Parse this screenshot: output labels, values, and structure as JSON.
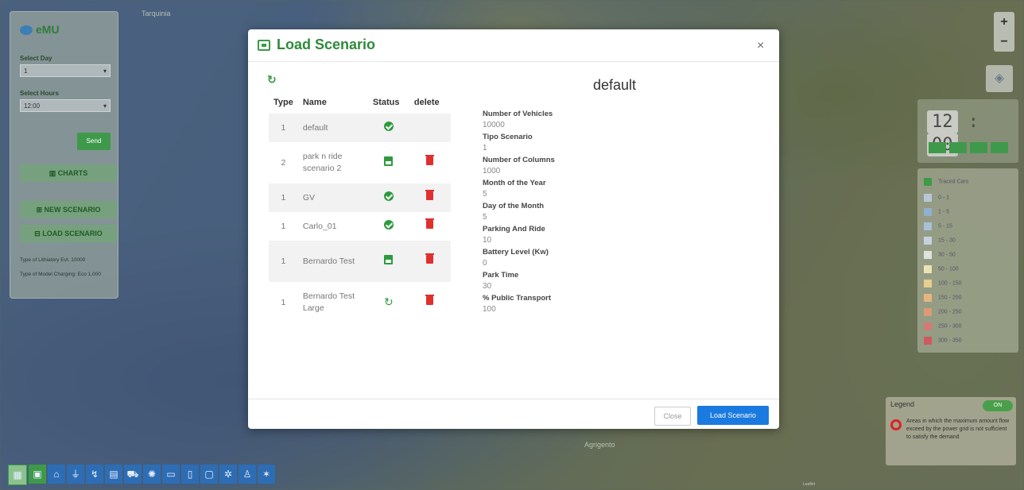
{
  "map": {
    "labels": [
      "Tarquinia",
      "Agrigento"
    ]
  },
  "left_panel": {
    "app_name": "eMU",
    "select_day_label": "Select Day",
    "select_day_value": "1",
    "select_hours_label": "Select Hours",
    "select_hours_value": "12:00",
    "send_label": "Send",
    "charts_label": "CHARTS",
    "new_scenario_label": "NEW SCENARIO",
    "load_scenario_label": "LOAD SCENARIO",
    "note_1": "Type of Lithiatery Evt. 10000",
    "note_2": "Type of Model Charging: Eco 1,000"
  },
  "clock": {
    "hours": "12",
    "minutes": "00"
  },
  "color_legend": {
    "title": "Traced Cars",
    "rows": [
      {
        "label": "0 - 1",
        "color": "#b8c7d6"
      },
      {
        "label": "1 - 5",
        "color": "#8fb0cf"
      },
      {
        "label": "5 - 15",
        "color": "#a7c1d9"
      },
      {
        "label": "15 - 30",
        "color": "#c4d2e0"
      },
      {
        "label": "30 - 50",
        "color": "#dfe3dc"
      },
      {
        "label": "50 - 100",
        "color": "#ece3b5"
      },
      {
        "label": "100 - 150",
        "color": "#e7cf8f"
      },
      {
        "label": "150 - 200",
        "color": "#e4b67e"
      },
      {
        "label": "200 - 250",
        "color": "#dc9b72"
      },
      {
        "label": "250 - 300",
        "color": "#d47b74"
      },
      {
        "label": "300 - 350",
        "color": "#cc5a63"
      }
    ]
  },
  "legend": {
    "title": "Legend",
    "toggle": "ON",
    "description": "Areas in which the maximum amount flow exceed by the power grid is not sufficient to satisfy the demand"
  },
  "modal": {
    "title": "Load Scenario",
    "close_symbol": "×",
    "table": {
      "headers": [
        "Type",
        "Name",
        "Status",
        "delete"
      ],
      "rows": [
        {
          "type": "1",
          "name": "default",
          "status": "ok",
          "deletable": false
        },
        {
          "type": "2",
          "name": "park n ride scenario 2",
          "status": "saved",
          "deletable": true
        },
        {
          "type": "1",
          "name": "GV",
          "status": "ok",
          "deletable": true
        },
        {
          "type": "1",
          "name": "Carlo_01",
          "status": "ok",
          "deletable": true
        },
        {
          "type": "1",
          "name": "Bernardo Test",
          "status": "saved",
          "deletable": true
        },
        {
          "type": "1",
          "name": "Bernardo Test Large",
          "status": "loading",
          "deletable": true
        }
      ]
    },
    "selected": {
      "name": "default",
      "fields": [
        {
          "label": "Number of Vehicles",
          "value": "10000"
        },
        {
          "label": "Tipo Scenario",
          "value": "1"
        },
        {
          "label": "Number of Columns",
          "value": "1000"
        },
        {
          "label": "Month of the Year",
          "value": "5"
        },
        {
          "label": "Day of the Month",
          "value": "5"
        },
        {
          "label": "Parking And Ride",
          "value": "10"
        },
        {
          "label": "Battery Level (Kw)",
          "value": "0"
        },
        {
          "label": "Park Time",
          "value": "30"
        },
        {
          "label": "% Public Transport",
          "value": "100"
        }
      ]
    },
    "footer": {
      "close_label": "Close",
      "load_label": "Load Scenario"
    }
  },
  "toolbar": {
    "icons": [
      "grid-icon",
      "save-icon",
      "home-icon",
      "plug-icon",
      "bolt-icon",
      "building-icon",
      "car-icon",
      "gear-icon",
      "bus-icon",
      "train-icon",
      "monitor-icon",
      "settings-icon",
      "person-icon",
      "star-icon"
    ]
  }
}
